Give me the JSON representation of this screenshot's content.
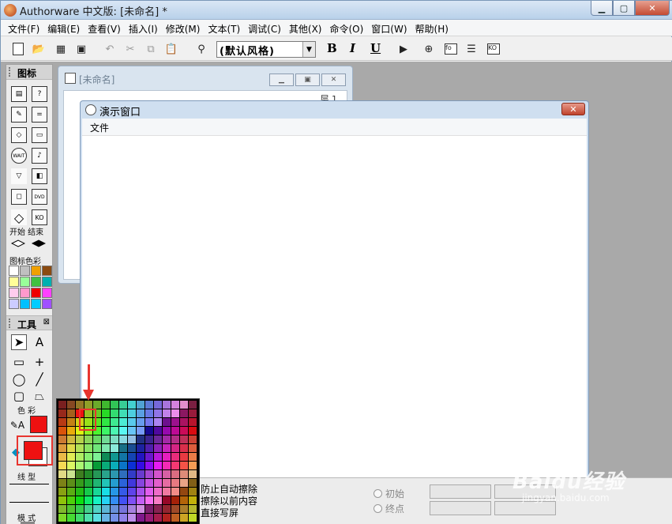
{
  "app": {
    "title": "Authorware 中文版: [未命名] *",
    "window_buttons": {
      "minimize": "▁",
      "maximize": "▢",
      "close": "✕"
    }
  },
  "menubar": {
    "items": [
      "文件(F)",
      "编辑(E)",
      "查看(V)",
      "插入(I)",
      "修改(M)",
      "文本(T)",
      "调试(C)",
      "其他(X)",
      "命令(O)",
      "窗口(W)",
      "帮助(H)"
    ]
  },
  "toolbar": {
    "style_value": "(默认风格)",
    "bold": "B",
    "italic": "I",
    "underline": "U"
  },
  "icon_palette": {
    "title": "图标",
    "start_end_label": "开始 结束",
    "icon_color_label": "图标色彩",
    "swatches": [
      "#ffffff",
      "#c0c0c0",
      "#f0a000",
      "#8b4a10",
      "#ffff99",
      "#99ff99",
      "#40c040",
      "#00b0b0",
      "#ffccee",
      "#ff99cc",
      "#ee0000",
      "#ff40ff",
      "#ccccff",
      "#00c0ff",
      "#00ccff",
      "#a050ff"
    ]
  },
  "tools_palette": {
    "title": "工具",
    "color_label": "色 彩",
    "line_label": "线 型",
    "mode_label": "模 式"
  },
  "flow_window": {
    "title": "[未命名]",
    "layer_label": "层 1"
  },
  "presentation_window": {
    "title": "演示窗口",
    "menu_file": "文件"
  },
  "properties": {
    "line1": "防止自动擦除",
    "line2": "擦除以前内容",
    "line3": "直接写屏",
    "radio_initial": "初始",
    "radio_end": "终点"
  },
  "color_popup": {
    "colors_hex": [
      "#ff8080",
      "#ffff80",
      "#80ff80",
      "#00ff80",
      "#80ffff",
      "#0080ff",
      "#ff80c0",
      "#ff80ff",
      "#ff0000",
      "#ffff00",
      "#80ff00",
      "#00ff40",
      "#00ffff",
      "#0080c0",
      "#8080c0",
      "#ff00ff"
    ],
    "selected_color": "#ee1111",
    "stroke_color": "#ee1111"
  },
  "watermark": {
    "brand": "Baidu经验",
    "url": "jingyan.baidu.com"
  }
}
